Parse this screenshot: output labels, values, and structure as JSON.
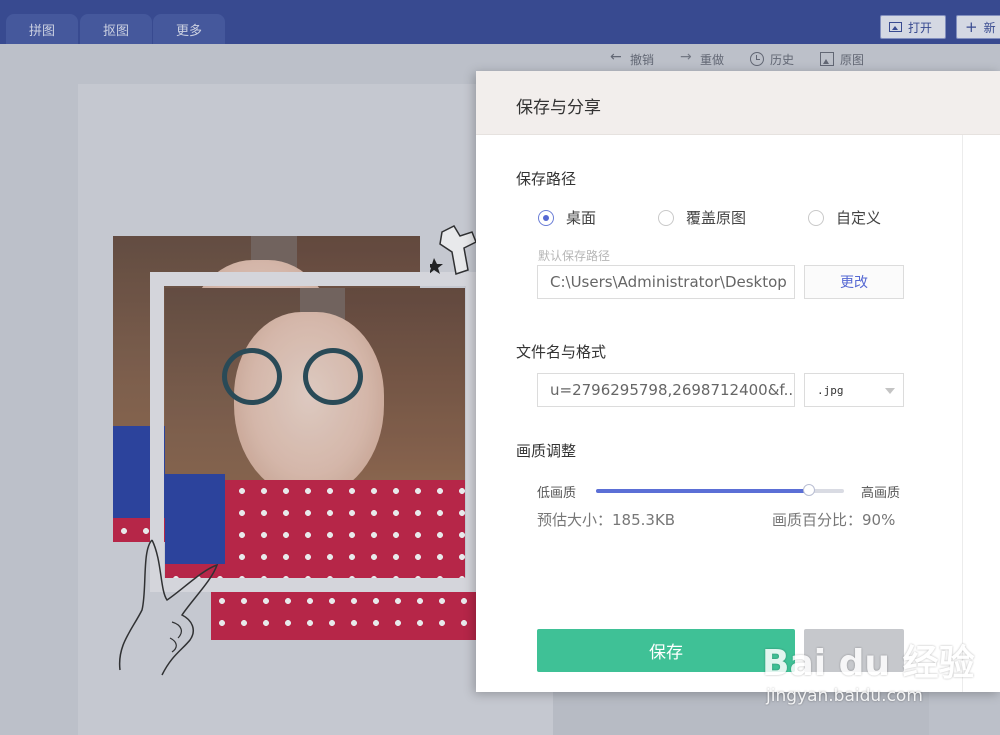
{
  "tabs": [
    {
      "label": "拼图"
    },
    {
      "label": "抠图"
    },
    {
      "label": "更多"
    }
  ],
  "top_actions": {
    "open_label": "打开",
    "new_label": "新"
  },
  "edit_toolbar": {
    "undo": "撤销",
    "redo": "重做",
    "history": "历史",
    "original": "原图"
  },
  "modal": {
    "title": "保存与分享",
    "save_path": {
      "title": "保存路径",
      "options": [
        {
          "label": "桌面",
          "checked": true
        },
        {
          "label": "覆盖原图",
          "checked": false
        },
        {
          "label": "自定义",
          "checked": false
        }
      ],
      "hint": "默认保存路径",
      "value": "C:\\Users\\Administrator\\Desktop",
      "change_label": "更改"
    },
    "file": {
      "title": "文件名与格式",
      "name_value": "u=2796295798,2698712400&f...",
      "format_value": ".jpg"
    },
    "quality": {
      "title": "画质调整",
      "low_label": "低画质",
      "high_label": "高画质",
      "level": 0.86,
      "estimated_size": "预估大小：185.3KB",
      "percent_text": "画质百分比：90%"
    },
    "save_label": "保存"
  },
  "watermark": {
    "logo": "Bai du 经验",
    "url": "jingyan.baidu.com"
  },
  "colors": {
    "topbar": "#3b4e9a",
    "accent": "#5568d3",
    "save_button": "#3fc196"
  }
}
